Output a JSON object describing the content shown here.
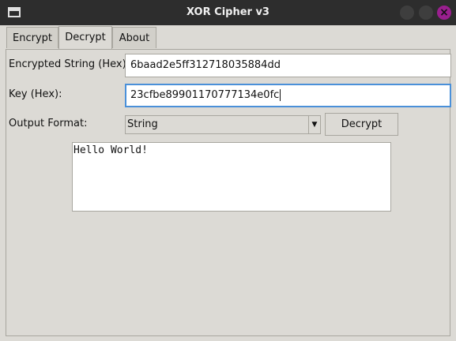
{
  "window": {
    "title": "XOR Cipher v3",
    "close_glyph": "×",
    "accent": "#9a1f8f",
    "titlebar_bg": "#2d2d2d"
  },
  "tabs": [
    {
      "label": "Encrypt",
      "selected": false
    },
    {
      "label": "Decrypt",
      "selected": true
    },
    {
      "label": "About",
      "selected": false
    }
  ],
  "decrypt": {
    "encrypted_label": "Encrypted String (Hex):",
    "encrypted_value": "6baad2e5ff312718035884dd",
    "key_label": "Key (Hex):",
    "key_value": "23cfbe89901170777134e0fc",
    "format_label": "Output Format:",
    "format_selected": "String",
    "combo_arrow_glyph": "▼",
    "decrypt_button": "Decrypt",
    "output_text": "Hello World!"
  }
}
